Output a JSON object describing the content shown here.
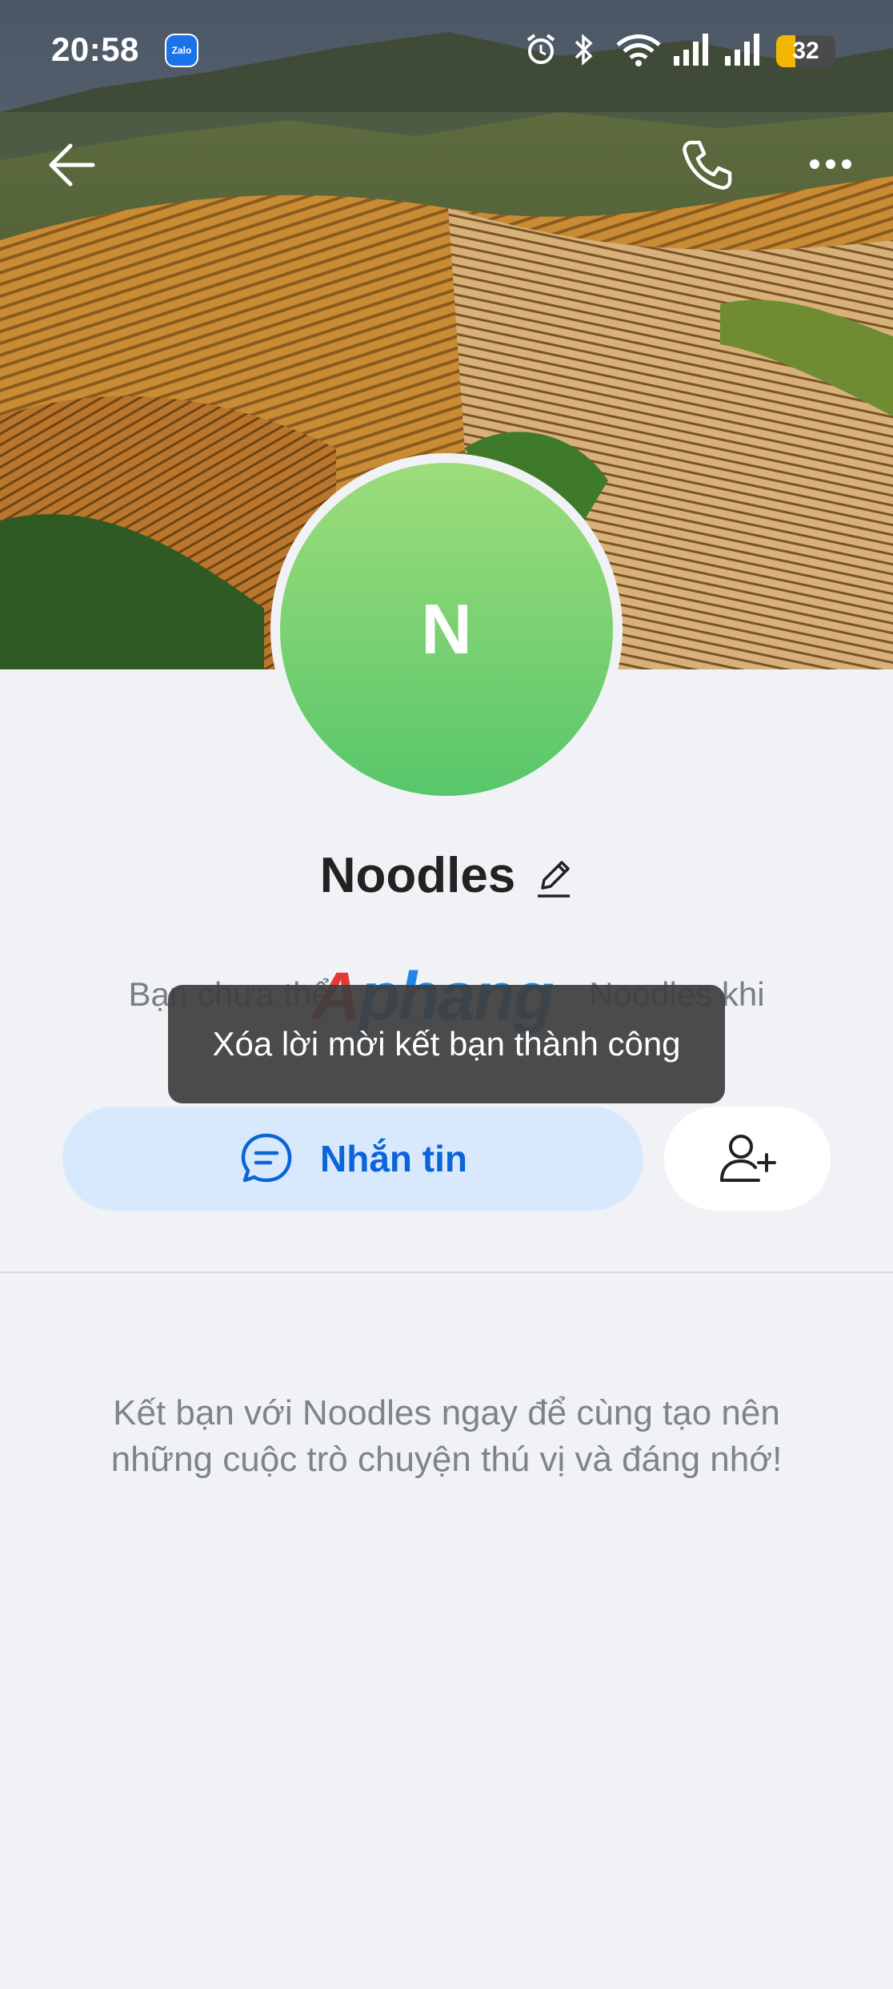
{
  "status_bar": {
    "time": "20:58",
    "app_badge": "Zalo",
    "battery_level": "32",
    "battery_fill_fraction": 0.32
  },
  "header": {
    "back_icon": "arrow-left-icon",
    "call_icon": "phone-icon",
    "more_icon": "more-horizontal-icon"
  },
  "profile": {
    "avatar_initial": "N",
    "avatar_color": "#58c76a",
    "name": "Noodles",
    "hint_left": "Bạn chưa thể",
    "hint_right": "Noodles khi"
  },
  "watermark": {
    "part1": "A",
    "part2": "phang"
  },
  "toast": {
    "text": "Xóa lời mời kết bạn thành công"
  },
  "actions": {
    "message_label": "Nhắn tin",
    "add_friend_icon": "user-plus-icon",
    "accent": "#0b65d9"
  },
  "cta": {
    "text": "Kết bạn với Noodles ngay để cùng tạo nên những cuộc trò chuyện thú vị và đáng nhớ!"
  }
}
